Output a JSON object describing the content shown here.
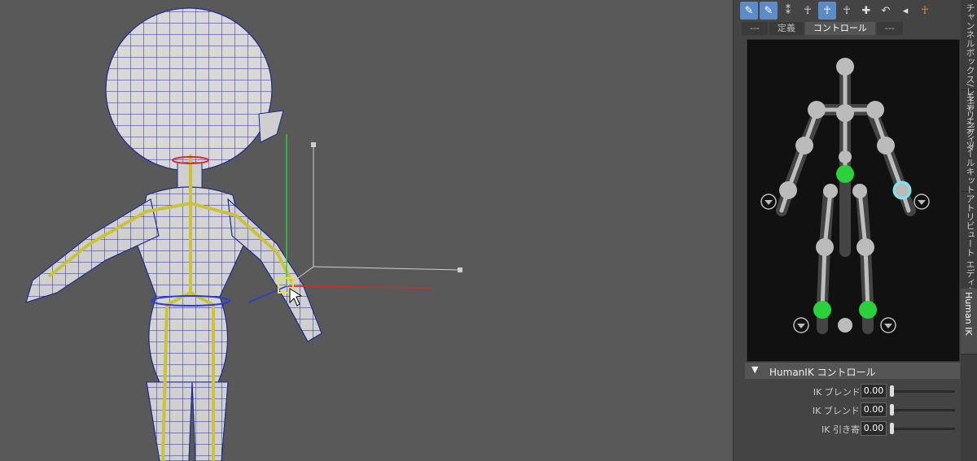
{
  "toolbar": {
    "buttons": [
      {
        "icon": "pencil-icon",
        "glyph": "✎",
        "active": true
      },
      {
        "icon": "pencil-icon",
        "glyph": "✎",
        "active": true
      },
      {
        "icon": "spine-icon",
        "glyph": "⁑",
        "active": false
      },
      {
        "icon": "figure-icon",
        "glyph": "☥",
        "active": false
      },
      {
        "icon": "figure-selected-icon",
        "glyph": "☥",
        "active": true
      },
      {
        "icon": "figure-icon",
        "glyph": "☥",
        "active": false
      },
      {
        "icon": "key-figure-icon",
        "glyph": "✚",
        "active": false
      },
      {
        "icon": "undo-figure-icon",
        "glyph": "↶",
        "active": false
      },
      {
        "icon": "pin-icon",
        "glyph": "◂",
        "active": false
      },
      {
        "icon": "character-icon",
        "glyph": "☥",
        "active": false,
        "color": "#f08a2a"
      }
    ]
  },
  "tabs": [
    "---",
    "定義",
    "コントロール",
    "---"
  ],
  "active_tab": 2,
  "side_tabs": [
    "チャンネルボックス/レイヤ エディタ",
    "モデリング ツールキット",
    "アトリビュート エディタ",
    "Human IK"
  ],
  "active_side_tab": 3,
  "section": {
    "title": "HumanIK コントロール",
    "expanded_icon": "triangle-down-icon"
  },
  "sliders": [
    {
      "label": "IK ブレンド T",
      "value": "0.00",
      "fraction": 0
    },
    {
      "label": "IK ブレンド R",
      "value": "0.00",
      "fraction": 0
    },
    {
      "label": "IK 引き寄せ",
      "value": "0.00",
      "fraction": 0
    }
  ],
  "colors": {
    "selected_joint": "#2bd13a",
    "active_button": "#5b8cc7",
    "accent_orange": "#f08a2a"
  }
}
